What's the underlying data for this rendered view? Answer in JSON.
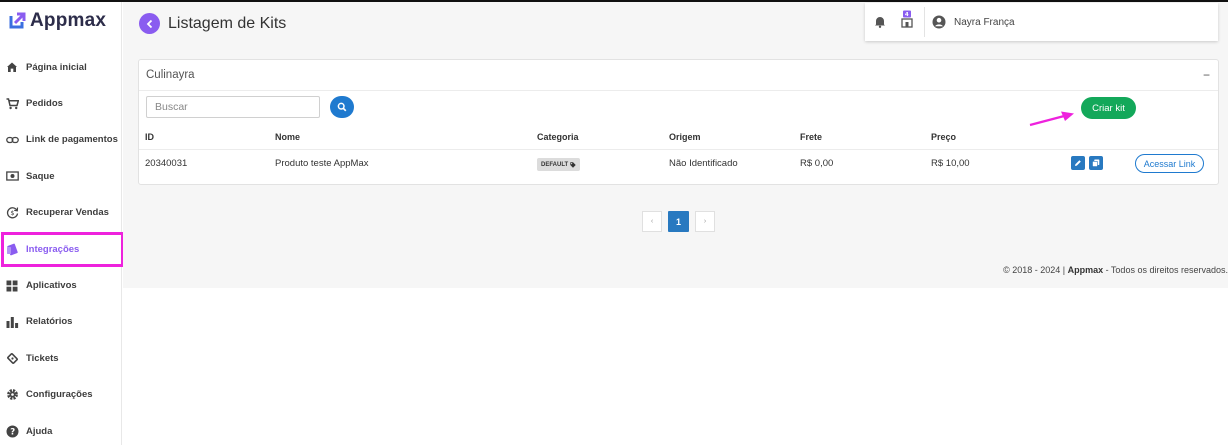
{
  "app": {
    "name": "Appmax"
  },
  "sidebar": {
    "items": [
      {
        "label": "Página inicial",
        "icon": "home-icon"
      },
      {
        "label": "Pedidos",
        "icon": "cart-icon"
      },
      {
        "label": "Link de pagamentos",
        "icon": "link-icon"
      },
      {
        "label": "Saque",
        "icon": "cash-icon"
      },
      {
        "label": "Recuperar Vendas",
        "icon": "recover-icon"
      },
      {
        "label": "Integrações",
        "icon": "integrations-icon",
        "active": true
      },
      {
        "label": "Aplicativos",
        "icon": "apps-icon"
      },
      {
        "label": "Relatórios",
        "icon": "bar-chart-icon"
      },
      {
        "label": "Tickets",
        "icon": "ticket-icon"
      },
      {
        "label": "Configurações",
        "icon": "gear-icon"
      },
      {
        "label": "Ajuda",
        "icon": "help-icon"
      }
    ]
  },
  "header": {
    "title": "Listagem de Kits"
  },
  "topbar": {
    "user_name": "Nayra França"
  },
  "card": {
    "title": "Culinayra",
    "collapse_symbol": "−",
    "search": {
      "placeholder": "Buscar"
    },
    "create_button": "Criar kit",
    "columns": [
      "ID",
      "Nome",
      "Categoria",
      "Origem",
      "Frete",
      "Preço"
    ],
    "rows": [
      {
        "id": "20340031",
        "nome": "Produto teste AppMax",
        "categoria": "DEFAULT",
        "origem": "Não Identificado",
        "frete": "R$ 0,00",
        "preco": "R$ 10,00",
        "link_label": "Acessar Link"
      }
    ]
  },
  "pagination": {
    "prev": "‹",
    "current": "1",
    "next": "›"
  },
  "footer": {
    "prefix": "© 2018 - 2024 | ",
    "brand": "Appmax",
    "suffix": " - Todos os direitos reservados."
  },
  "colors": {
    "accent": "#8a5cf0",
    "primary": "#2879c0",
    "success": "#13a85a",
    "highlight": "#ee22dd"
  }
}
